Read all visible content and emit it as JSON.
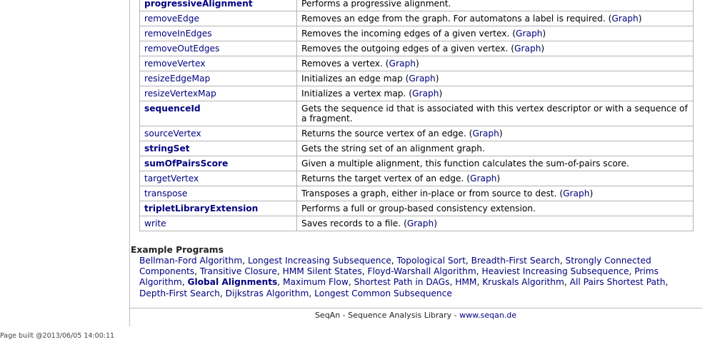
{
  "functions": [
    {
      "name": "progressiveAlignment",
      "bold": true,
      "desc": "Performs a progressive alignment.",
      "link": ""
    },
    {
      "name": "removeEdge",
      "bold": false,
      "desc": "Removes an edge from the graph. For automatons a label is required. ",
      "link": "Graph"
    },
    {
      "name": "removeInEdges",
      "bold": false,
      "desc": "Removes the incoming edges of a given vertex. ",
      "link": "Graph"
    },
    {
      "name": "removeOutEdges",
      "bold": false,
      "desc": "Removes the outgoing edges of a given vertex. ",
      "link": "Graph"
    },
    {
      "name": "removeVertex",
      "bold": false,
      "desc": "Removes a vertex. ",
      "link": "Graph"
    },
    {
      "name": "resizeEdgeMap",
      "bold": false,
      "desc": "Initializes an edge map ",
      "link": "Graph"
    },
    {
      "name": "resizeVertexMap",
      "bold": false,
      "desc": "Initializes a vertex map. ",
      "link": "Graph"
    },
    {
      "name": "sequenceId",
      "bold": true,
      "desc": "Gets the sequence id that is associated with this vertex descriptor or with a sequence of a fragment.",
      "link": ""
    },
    {
      "name": "sourceVertex",
      "bold": false,
      "desc": "Returns the source vertex of an edge. ",
      "link": "Graph"
    },
    {
      "name": "stringSet",
      "bold": true,
      "desc": "Gets the string set of an alignment graph.",
      "link": ""
    },
    {
      "name": "sumOfPairsScore",
      "bold": true,
      "desc": "Given a multiple alignment, this function calculates the sum-of-pairs score.",
      "link": ""
    },
    {
      "name": "targetVertex",
      "bold": false,
      "desc": "Returns the target vertex of an edge. ",
      "link": "Graph"
    },
    {
      "name": "transpose",
      "bold": false,
      "desc": "Transposes a graph, either in-place or from source to dest. ",
      "link": "Graph"
    },
    {
      "name": "tripletLibraryExtension",
      "bold": true,
      "desc": "Performs a full or group-based consistency extension.",
      "link": ""
    },
    {
      "name": "write",
      "bold": false,
      "desc": "Saves records to a file. ",
      "link": "Graph"
    }
  ],
  "examples": {
    "heading": "Example Programs",
    "items": [
      {
        "label": "Bellman-Ford Algorithm",
        "bold": false
      },
      {
        "label": "Longest Increasing Subsequence",
        "bold": false
      },
      {
        "label": "Topological Sort",
        "bold": false
      },
      {
        "label": "Breadth-First Search",
        "bold": false
      },
      {
        "label": "Strongly Connected Components",
        "bold": false
      },
      {
        "label": "Transitive Closure",
        "bold": false
      },
      {
        "label": "HMM Silent States",
        "bold": false
      },
      {
        "label": "Floyd-Warshall Algorithm",
        "bold": false
      },
      {
        "label": "Heaviest Increasing Subsequence",
        "bold": false
      },
      {
        "label": "Prims Algorithm",
        "bold": false
      },
      {
        "label": "Global Alignments",
        "bold": true
      },
      {
        "label": "Maximum Flow",
        "bold": false
      },
      {
        "label": "Shortest Path in DAGs",
        "bold": false
      },
      {
        "label": "HMM",
        "bold": false
      },
      {
        "label": "Kruskals Algorithm",
        "bold": false
      },
      {
        "label": "All Pairs Shortest Path",
        "bold": false
      },
      {
        "label": "Depth-First Search",
        "bold": false
      },
      {
        "label": "Dijkstras Algorithm",
        "bold": false
      },
      {
        "label": "Longest Common Subsequence",
        "bold": false
      }
    ]
  },
  "footer": {
    "text": "SeqAn - Sequence Analysis Library - ",
    "link": "www.seqan.de"
  },
  "built": "Page built @2013/06/05 14:00:11",
  "colors": {
    "link": "#000080",
    "border": "#b4b4b4"
  }
}
